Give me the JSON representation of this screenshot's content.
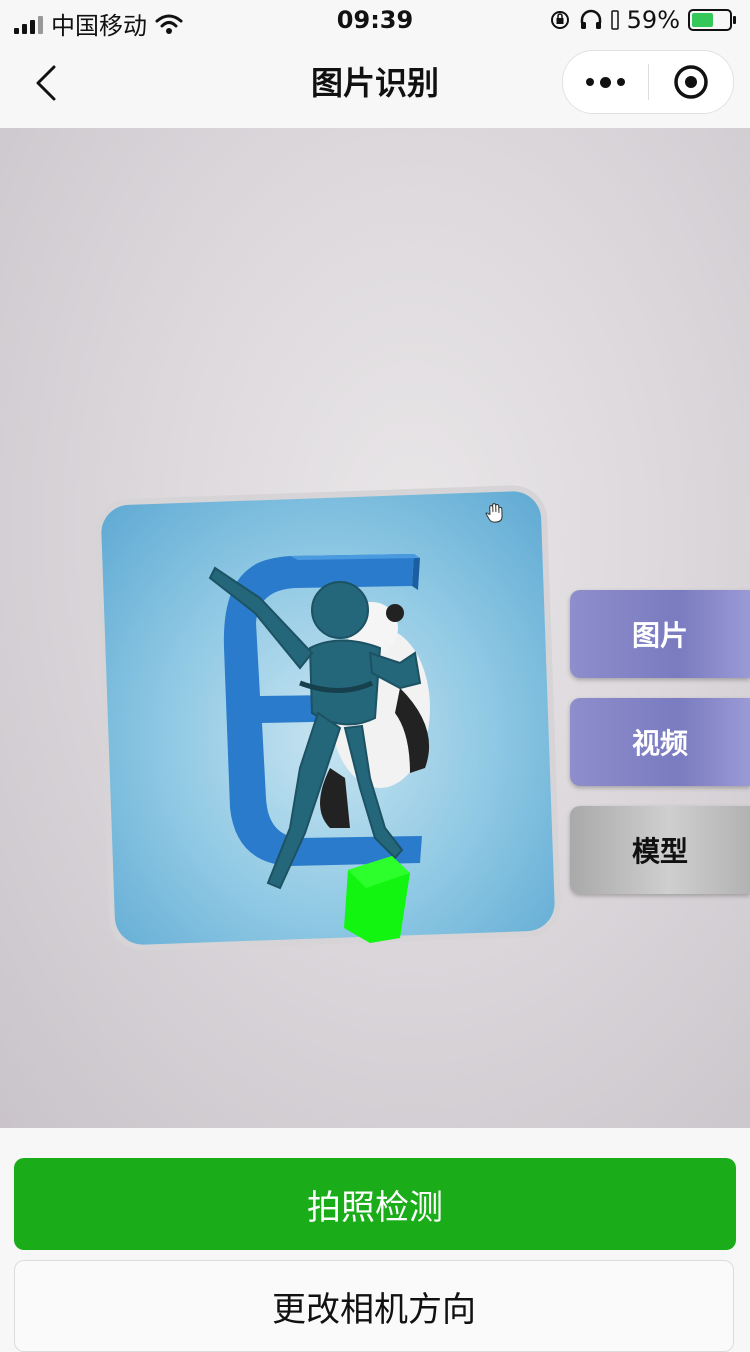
{
  "status_bar": {
    "carrier": "中国移动",
    "time": "09:39",
    "battery_percent": "59%",
    "battery_level": 0.59,
    "icons": [
      "signal-icon",
      "wifi-icon",
      "orientation-lock-icon",
      "headphones-icon",
      "battery-charging-icon"
    ]
  },
  "nav": {
    "title": "图片识别",
    "icons": [
      "back-icon",
      "more-icon",
      "close-target-icon"
    ]
  },
  "ar_modes": [
    {
      "label": "图片",
      "style": "purple"
    },
    {
      "label": "视频",
      "style": "purple"
    },
    {
      "label": "模型",
      "style": "grey"
    }
  ],
  "actions": {
    "capture_label": "拍照检测",
    "switch_camera_label": "更改相机方向"
  },
  "colors": {
    "primary_green": "#1aad19",
    "mode_purple": "#7a7bc0",
    "mode_grey": "#bdbdbd",
    "model_cube": "#11f511",
    "model_figure": "#24667a",
    "letter_blue": "#2a7bcc"
  }
}
